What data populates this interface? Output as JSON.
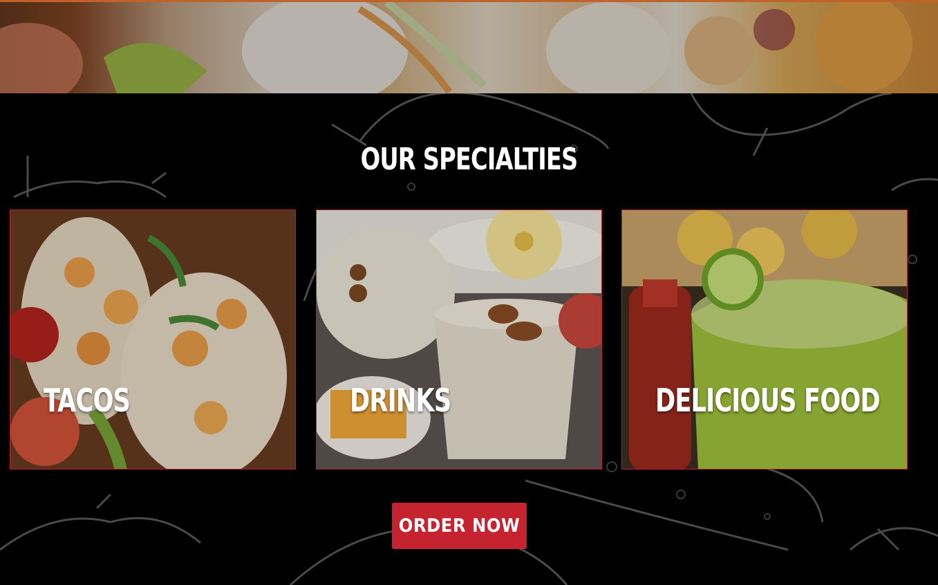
{
  "specialties": {
    "title": "OUR SPECIALTIES",
    "cards": [
      {
        "label": "TACOS"
      },
      {
        "label": "DRINKS"
      },
      {
        "label": "DELICIOUS FOOD"
      }
    ]
  },
  "cta": {
    "order_label": "ORDER NOW"
  },
  "colors": {
    "accent": "#c4232f",
    "background": "#000000",
    "hero_border": "#c0622a"
  }
}
